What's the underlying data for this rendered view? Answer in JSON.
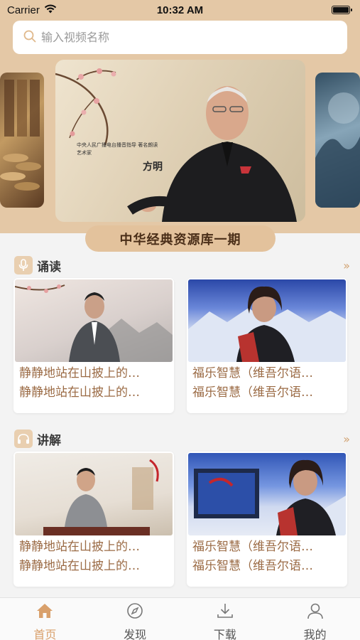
{
  "status_bar": {
    "carrier": "Carrier",
    "time": "10:32 AM"
  },
  "search": {
    "placeholder": "输入视频名称"
  },
  "carousel": {
    "current_label": "中华经典资源库一期",
    "banner_caption": "方明",
    "banner_subtitle": "中央人民广播电台播音指导 著名朗读艺术家"
  },
  "sections": [
    {
      "title": "诵读",
      "icon": "microphone-icon",
      "cards": [
        {
          "line1": "静静地站在山披上的…",
          "line2": "静静地站在山披上的…"
        },
        {
          "line1": "福乐智慧（维吾尔语…",
          "line2": "福乐智慧（维吾尔语…"
        }
      ]
    },
    {
      "title": "讲解",
      "icon": "headphones-icon",
      "cards": [
        {
          "line1": "静静地站在山披上的…",
          "line2": "静静地站在山披上的…"
        },
        {
          "line1": "福乐智慧（维吾尔语…",
          "line2": "福乐智慧（维吾尔语…"
        }
      ]
    }
  ],
  "tab_bar": {
    "tabs": [
      {
        "label": "首页",
        "icon": "home-icon",
        "active": true
      },
      {
        "label": "发现",
        "icon": "compass-icon",
        "active": false
      },
      {
        "label": "下载",
        "icon": "download-icon",
        "active": false
      },
      {
        "label": "我的",
        "icon": "user-icon",
        "active": false
      }
    ]
  },
  "colors": {
    "header_bg": "#e4c8a6",
    "accent": "#d9a06b",
    "card_text": "#9b6b45"
  }
}
